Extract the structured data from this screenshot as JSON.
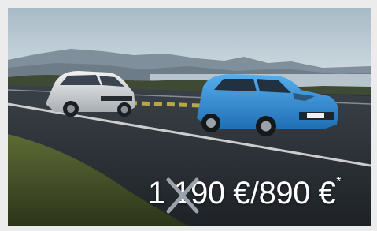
{
  "promo": {
    "old_price": "1 190 €",
    "separator": " / ",
    "new_price": "890 €",
    "footnote_mark": "*"
  },
  "image": {
    "subject": "car-photo",
    "colors": {
      "sky": "#b9c9d4",
      "road": "#2b3036",
      "blue_car": "#2f8fd6",
      "silver_car": "#d9dde0",
      "grass": "#4b5a2e",
      "price_text": "#ffffff",
      "cross": "#9aa3ab"
    }
  }
}
